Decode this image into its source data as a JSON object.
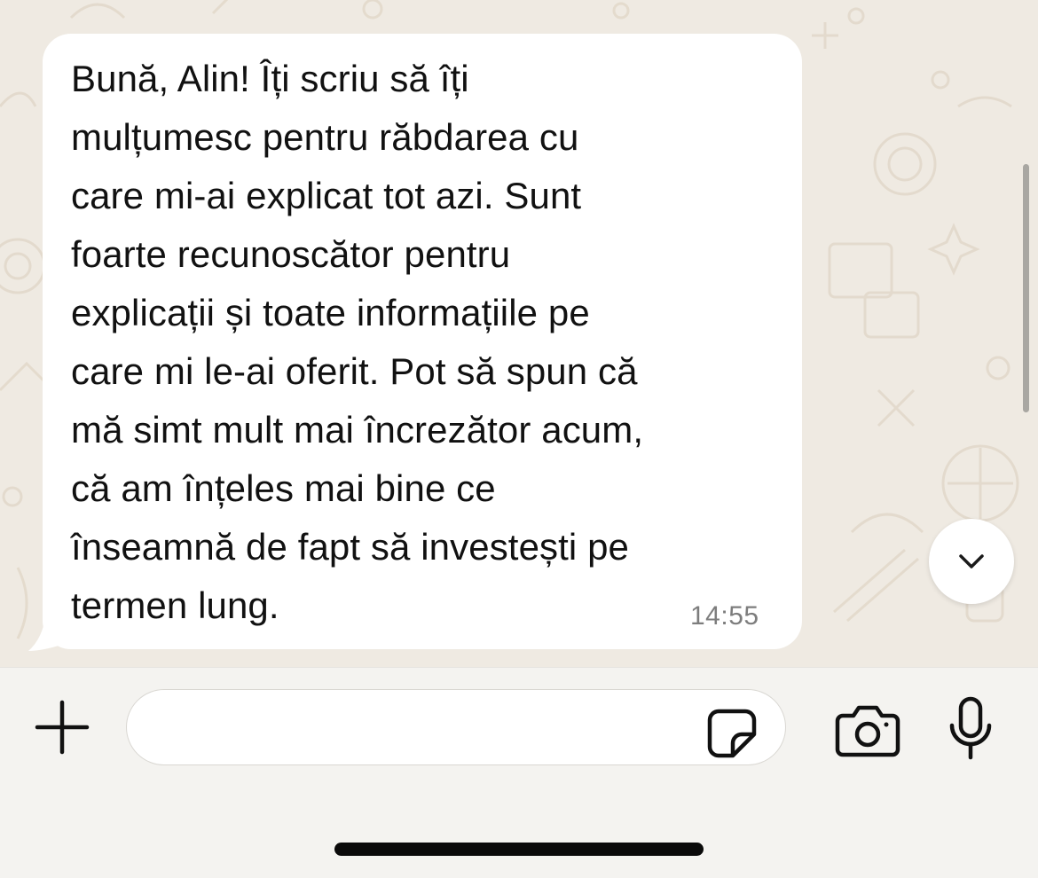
{
  "message": {
    "lines": [
      "Bună, Alin! Îți scriu să îți",
      "mulțumesc pentru răbdarea cu",
      "care mi-ai explicat tot azi. Sunt",
      "foarte recunoscător pentru",
      "explicații și toate informațiile pe",
      "care mi le-ai oferit. Pot să spun că",
      "mă simt mult mai încrezător acum,",
      "că am înțeles mai bine ce",
      "înseamnă de fapt să investești pe",
      "termen lung."
    ],
    "time": "14:55"
  },
  "input": {
    "placeholder": "",
    "value": ""
  },
  "icons": {
    "attach": "plus-icon",
    "sticker": "sticker-icon",
    "camera": "camera-icon",
    "voice": "microphone-icon",
    "scroll": "chevron-down-icon"
  },
  "colors": {
    "wallpaper": "#efeae2",
    "bubble": "#ffffff",
    "text": "#111111",
    "timestamp": "#7d7d7d",
    "input_bar": "#f4f3f0"
  }
}
